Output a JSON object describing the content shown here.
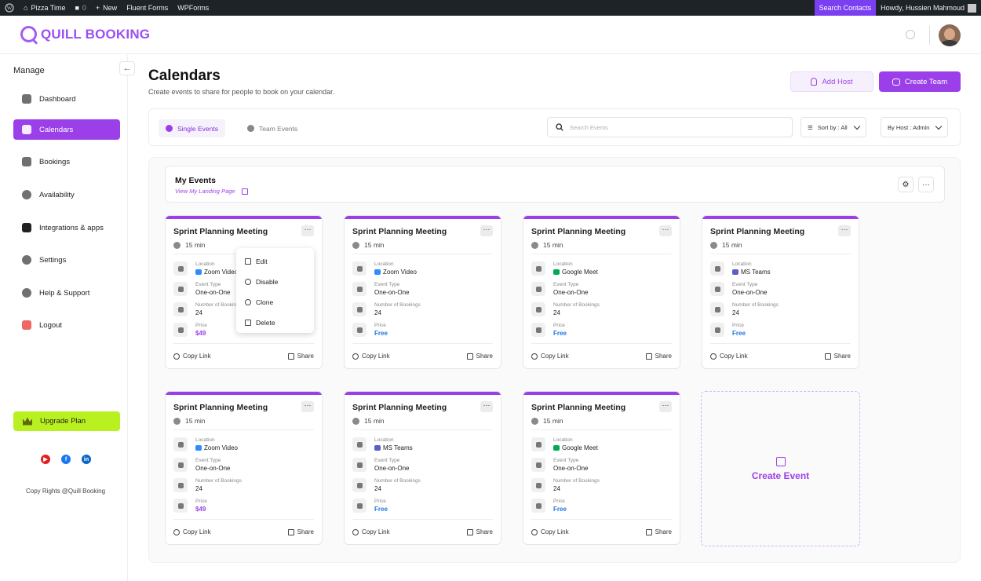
{
  "adminbar": {
    "site": "Pizza Time",
    "comments": "0",
    "new": "New",
    "fluent": "Fluent Forms",
    "wpforms": "WPForms",
    "search_contacts": "Search Contacts",
    "howdy": "Howdy, Hussien Mahmoud"
  },
  "brand": {
    "name": "QUILL BOOKING",
    "accent": "#9b3fe8",
    "upgrade_color": "#b9f01f"
  },
  "sidebar": {
    "section": "Manage",
    "items": [
      {
        "label": "Dashboard"
      },
      {
        "label": "Calendars"
      },
      {
        "label": "Bookings"
      },
      {
        "label": "Availability"
      },
      {
        "label": "Integrations & apps"
      },
      {
        "label": "Settings"
      },
      {
        "label": "Help & Support"
      },
      {
        "label": "Logout"
      }
    ],
    "upgrade": "Upgrade Plan",
    "copyright": "Copy Rights  @Quill Booking"
  },
  "header": {
    "title": "Calendars",
    "subtitle": "Create events to share for people to book on your calendar.",
    "add_host": "Add Host",
    "create_team": "Create  Team"
  },
  "toolbar": {
    "tab_single": "Single Events",
    "tab_team": "Team Events",
    "search_placeholder": "Search Events",
    "sort": "Sort by : All",
    "host": "By Host : Admin"
  },
  "my_events": {
    "title": "My Events",
    "landing": "View My Landing Page"
  },
  "labels": {
    "location": "Location",
    "event_type": "Event Type",
    "bookings": "Number of Bookings",
    "price": "Price",
    "copy": "Copy Link",
    "share": "Share"
  },
  "cards": [
    {
      "title": "Sprint Planning Meeting",
      "duration": "15 min",
      "location": "Zoom Video",
      "type": "One-on-One",
      "bookings": "24",
      "price": "$49",
      "free": false
    },
    {
      "title": "Sprint Planning Meeting",
      "duration": "15 min",
      "location": "Zoom Video",
      "type": "One-on-One",
      "bookings": "24",
      "price": "Free",
      "free": true
    },
    {
      "title": "Sprint Planning Meeting",
      "duration": "15 min",
      "location": "Google Meet",
      "type": "One-on-One",
      "bookings": "24",
      "price": "Free",
      "free": true
    },
    {
      "title": "Sprint Planning Meeting",
      "duration": "15 min",
      "location": "MS Teams",
      "type": "One-on-One",
      "bookings": "24",
      "price": "Free",
      "free": true
    },
    {
      "title": "Sprint Planning Meeting",
      "duration": "15 min",
      "location": "Zoom Video",
      "type": "One-on-One",
      "bookings": "24",
      "price": "$49",
      "free": false
    },
    {
      "title": "Sprint Planning Meeting",
      "duration": "15 min",
      "location": "MS Teams",
      "type": "One-on-One",
      "bookings": "24",
      "price": "Free",
      "free": true
    },
    {
      "title": "Sprint Planning Meeting",
      "duration": "15 min",
      "location": "Google Meet",
      "type": "One-on-One",
      "bookings": "24",
      "price": "Free",
      "free": true
    }
  ],
  "menu": {
    "edit": "Edit",
    "disable": "Disable",
    "clone": "Clone",
    "delete": "Delete"
  },
  "create_event": "Create Event"
}
